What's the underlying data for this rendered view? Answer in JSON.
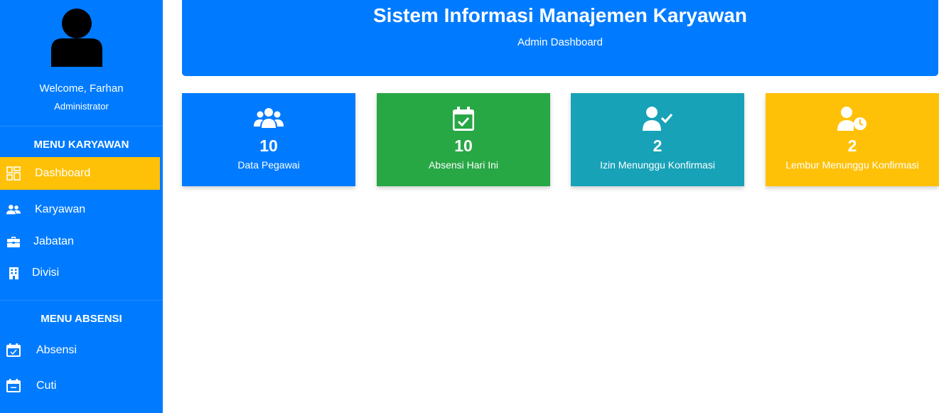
{
  "sidebar": {
    "welcome": "Welcome, Farhan",
    "role": "Administrator",
    "sections": [
      {
        "title": "MENU KARYAWAN",
        "items": [
          {
            "label": "Dashboard",
            "icon": "dashboard-icon",
            "active": true
          },
          {
            "label": "Karyawan",
            "icon": "users-icon"
          },
          {
            "label": "Jabatan",
            "icon": "briefcase-icon"
          },
          {
            "label": "Divisi",
            "icon": "building-icon"
          }
        ]
      },
      {
        "title": "MENU ABSENSI",
        "items": [
          {
            "label": "Absensi",
            "icon": "calendar-check-icon"
          },
          {
            "label": "Cuti",
            "icon": "calendar-minus-icon"
          }
        ]
      }
    ]
  },
  "header": {
    "title": "Sistem Informasi Manajemen Karyawan",
    "subtitle": "Admin Dashboard"
  },
  "cards": [
    {
      "value": "10",
      "label": "Data Pegawai",
      "icon": "users-icon",
      "color": "#007bff"
    },
    {
      "value": "10",
      "label": "Absensi Hari Ini",
      "icon": "calendar-check-icon",
      "color": "#28a745"
    },
    {
      "value": "2",
      "label": "Izin Menunggu Konfirmasi",
      "icon": "user-check-icon",
      "color": "#17a2b8"
    },
    {
      "value": "2",
      "label": "Lembur Menunggu Konfirmasi",
      "icon": "user-clock-icon",
      "color": "#ffc107"
    }
  ],
  "colors": {
    "primary": "#007bff",
    "active": "#ffc107",
    "success": "#28a745",
    "info": "#17a2b8"
  }
}
